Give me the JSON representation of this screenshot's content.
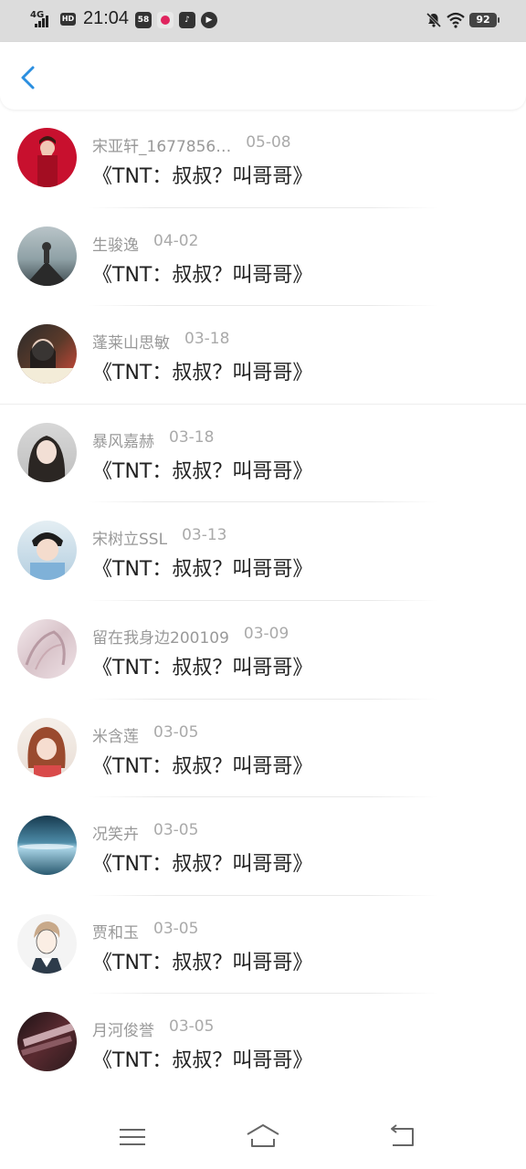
{
  "status_bar": {
    "network": "4G",
    "hd": "HD",
    "time": "21:04",
    "app1": "58",
    "battery": "92"
  },
  "colors": {
    "accent": "#2b8fe0"
  },
  "items": [
    {
      "name": "宋亚轩_1677856…",
      "date": "05-08",
      "title": "《TNT：叔叔？叫哥哥》"
    },
    {
      "name": "生骏逸",
      "date": "04-02",
      "title": "《TNT：叔叔？叫哥哥》"
    },
    {
      "name": "蓬莱山思敏",
      "date": "03-18",
      "title": "《TNT：叔叔？叫哥哥》"
    },
    {
      "name": "暴风嘉赫",
      "date": "03-18",
      "title": "《TNT：叔叔？叫哥哥》"
    },
    {
      "name": "宋树立SSL",
      "date": "03-13",
      "title": "《TNT：叔叔？叫哥哥》"
    },
    {
      "name": "留在我身边200109",
      "date": "03-09",
      "title": "《TNT：叔叔？叫哥哥》"
    },
    {
      "name": "米含莲",
      "date": "03-05",
      "title": "《TNT：叔叔？叫哥哥》"
    },
    {
      "name": "况笑卉",
      "date": "03-05",
      "title": "《TNT：叔叔？叫哥哥》"
    },
    {
      "name": "贾和玉",
      "date": "03-05",
      "title": "《TNT：叔叔？叫哥哥》"
    },
    {
      "name": "月河俊誉",
      "date": "03-05",
      "title": "《TNT：叔叔？叫哥哥》"
    }
  ]
}
